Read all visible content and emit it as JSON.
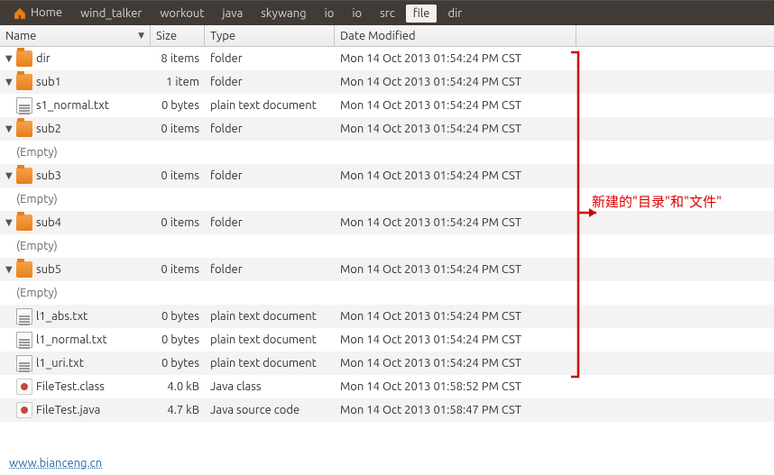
{
  "breadcrumb": {
    "items": [
      "Home",
      "wind_talker",
      "workout",
      "java",
      "skywang",
      "io",
      "io",
      "src",
      "file",
      "dir"
    ],
    "activeIndex": 8
  },
  "columns": {
    "name": "Name",
    "size": "Size",
    "type": "Type",
    "modified": "Date Modified"
  },
  "rows": [
    {
      "indent": 0,
      "expand": "▼",
      "icon": "folder",
      "name": "dir",
      "size": "8 items",
      "type": "folder",
      "mod": "Mon 14 Oct 2013 01:54:24 PM CST"
    },
    {
      "indent": 1,
      "expand": "▼",
      "icon": "folder",
      "name": "sub1",
      "size": "1 item",
      "type": "folder",
      "mod": "Mon 14 Oct 2013 01:54:24 PM CST"
    },
    {
      "indent": 2,
      "expand": "",
      "icon": "text",
      "name": "s1_normal.txt",
      "size": "0 bytes",
      "type": "plain text document",
      "mod": "Mon 14 Oct 2013 01:54:24 PM CST"
    },
    {
      "indent": 1,
      "expand": "▼",
      "icon": "folder",
      "name": "sub2",
      "size": "0 items",
      "type": "folder",
      "mod": "Mon 14 Oct 2013 01:54:24 PM CST"
    },
    {
      "indent": 2,
      "expand": "",
      "icon": "",
      "name": "(Empty)",
      "size": "",
      "type": "",
      "mod": "",
      "empty": true
    },
    {
      "indent": 1,
      "expand": "▼",
      "icon": "folder",
      "name": "sub3",
      "size": "0 items",
      "type": "folder",
      "mod": "Mon 14 Oct 2013 01:54:24 PM CST"
    },
    {
      "indent": 2,
      "expand": "",
      "icon": "",
      "name": "(Empty)",
      "size": "",
      "type": "",
      "mod": "",
      "empty": true
    },
    {
      "indent": 1,
      "expand": "▼",
      "icon": "folder",
      "name": "sub4",
      "size": "0 items",
      "type": "folder",
      "mod": "Mon 14 Oct 2013 01:54:24 PM CST"
    },
    {
      "indent": 2,
      "expand": "",
      "icon": "",
      "name": "(Empty)",
      "size": "",
      "type": "",
      "mod": "",
      "empty": true
    },
    {
      "indent": 1,
      "expand": "▼",
      "icon": "folder",
      "name": "sub5",
      "size": "0 items",
      "type": "folder",
      "mod": "Mon 14 Oct 2013 01:54:24 PM CST"
    },
    {
      "indent": 2,
      "expand": "",
      "icon": "",
      "name": "(Empty)",
      "size": "",
      "type": "",
      "mod": "",
      "empty": true
    },
    {
      "indent": 1,
      "expand": "",
      "icon": "text",
      "name": "l1_abs.txt",
      "size": "0 bytes",
      "type": "plain text document",
      "mod": "Mon 14 Oct 2013 01:54:24 PM CST"
    },
    {
      "indent": 1,
      "expand": "",
      "icon": "text",
      "name": "l1_normal.txt",
      "size": "0 bytes",
      "type": "plain text document",
      "mod": "Mon 14 Oct 2013 01:54:24 PM CST"
    },
    {
      "indent": 1,
      "expand": "",
      "icon": "text",
      "name": "l1_uri.txt",
      "size": "0 bytes",
      "type": "plain text document",
      "mod": "Mon 14 Oct 2013 01:54:24 PM CST"
    },
    {
      "indent": 0,
      "expand": "",
      "icon": "java",
      "name": "FileTest.class",
      "size": "4.0 kB",
      "type": "Java class",
      "mod": "Mon 14 Oct 2013 01:58:52 PM CST"
    },
    {
      "indent": 0,
      "expand": "",
      "icon": "java",
      "name": "FileTest.java",
      "size": "4.7 kB",
      "type": "Java source code",
      "mod": "Mon 14 Oct 2013 01:58:47 PM CST"
    }
  ],
  "annotation": {
    "label": "新建的\"目录\"和\"文件\"",
    "color": "#d00000"
  },
  "footer": {
    "link": "www.bianceng.cn"
  }
}
